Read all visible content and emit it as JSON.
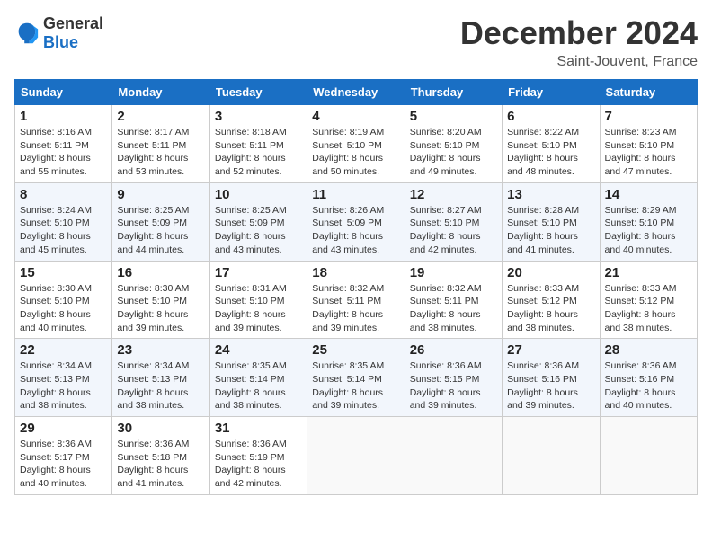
{
  "header": {
    "logo": {
      "general": "General",
      "blue": "Blue"
    },
    "title": "December 2024",
    "location": "Saint-Jouvent, France"
  },
  "calendar": {
    "days_of_week": [
      "Sunday",
      "Monday",
      "Tuesday",
      "Wednesday",
      "Thursday",
      "Friday",
      "Saturday"
    ],
    "weeks": [
      [
        null,
        null,
        {
          "day": "3",
          "sunrise": "Sunrise: 8:18 AM",
          "sunset": "Sunset: 5:11 PM",
          "daylight": "Daylight: 8 hours and 52 minutes."
        },
        {
          "day": "4",
          "sunrise": "Sunrise: 8:19 AM",
          "sunset": "Sunset: 5:10 PM",
          "daylight": "Daylight: 8 hours and 50 minutes."
        },
        {
          "day": "5",
          "sunrise": "Sunrise: 8:20 AM",
          "sunset": "Sunset: 5:10 PM",
          "daylight": "Daylight: 8 hours and 49 minutes."
        },
        {
          "day": "6",
          "sunrise": "Sunrise: 8:22 AM",
          "sunset": "Sunset: 5:10 PM",
          "daylight": "Daylight: 8 hours and 48 minutes."
        },
        {
          "day": "7",
          "sunrise": "Sunrise: 8:23 AM",
          "sunset": "Sunset: 5:10 PM",
          "daylight": "Daylight: 8 hours and 47 minutes."
        }
      ],
      [
        {
          "day": "1",
          "sunrise": "Sunrise: 8:16 AM",
          "sunset": "Sunset: 5:11 PM",
          "daylight": "Daylight: 8 hours and 55 minutes."
        },
        {
          "day": "2",
          "sunrise": "Sunrise: 8:17 AM",
          "sunset": "Sunset: 5:11 PM",
          "daylight": "Daylight: 8 hours and 53 minutes."
        },
        null,
        null,
        null,
        null,
        null
      ],
      [
        {
          "day": "8",
          "sunrise": "Sunrise: 8:24 AM",
          "sunset": "Sunset: 5:10 PM",
          "daylight": "Daylight: 8 hours and 45 minutes."
        },
        {
          "day": "9",
          "sunrise": "Sunrise: 8:25 AM",
          "sunset": "Sunset: 5:09 PM",
          "daylight": "Daylight: 8 hours and 44 minutes."
        },
        {
          "day": "10",
          "sunrise": "Sunrise: 8:25 AM",
          "sunset": "Sunset: 5:09 PM",
          "daylight": "Daylight: 8 hours and 43 minutes."
        },
        {
          "day": "11",
          "sunrise": "Sunrise: 8:26 AM",
          "sunset": "Sunset: 5:09 PM",
          "daylight": "Daylight: 8 hours and 43 minutes."
        },
        {
          "day": "12",
          "sunrise": "Sunrise: 8:27 AM",
          "sunset": "Sunset: 5:10 PM",
          "daylight": "Daylight: 8 hours and 42 minutes."
        },
        {
          "day": "13",
          "sunrise": "Sunrise: 8:28 AM",
          "sunset": "Sunset: 5:10 PM",
          "daylight": "Daylight: 8 hours and 41 minutes."
        },
        {
          "day": "14",
          "sunrise": "Sunrise: 8:29 AM",
          "sunset": "Sunset: 5:10 PM",
          "daylight": "Daylight: 8 hours and 40 minutes."
        }
      ],
      [
        {
          "day": "15",
          "sunrise": "Sunrise: 8:30 AM",
          "sunset": "Sunset: 5:10 PM",
          "daylight": "Daylight: 8 hours and 40 minutes."
        },
        {
          "day": "16",
          "sunrise": "Sunrise: 8:30 AM",
          "sunset": "Sunset: 5:10 PM",
          "daylight": "Daylight: 8 hours and 39 minutes."
        },
        {
          "day": "17",
          "sunrise": "Sunrise: 8:31 AM",
          "sunset": "Sunset: 5:10 PM",
          "daylight": "Daylight: 8 hours and 39 minutes."
        },
        {
          "day": "18",
          "sunrise": "Sunrise: 8:32 AM",
          "sunset": "Sunset: 5:11 PM",
          "daylight": "Daylight: 8 hours and 39 minutes."
        },
        {
          "day": "19",
          "sunrise": "Sunrise: 8:32 AM",
          "sunset": "Sunset: 5:11 PM",
          "daylight": "Daylight: 8 hours and 38 minutes."
        },
        {
          "day": "20",
          "sunrise": "Sunrise: 8:33 AM",
          "sunset": "Sunset: 5:12 PM",
          "daylight": "Daylight: 8 hours and 38 minutes."
        },
        {
          "day": "21",
          "sunrise": "Sunrise: 8:33 AM",
          "sunset": "Sunset: 5:12 PM",
          "daylight": "Daylight: 8 hours and 38 minutes."
        }
      ],
      [
        {
          "day": "22",
          "sunrise": "Sunrise: 8:34 AM",
          "sunset": "Sunset: 5:13 PM",
          "daylight": "Daylight: 8 hours and 38 minutes."
        },
        {
          "day": "23",
          "sunrise": "Sunrise: 8:34 AM",
          "sunset": "Sunset: 5:13 PM",
          "daylight": "Daylight: 8 hours and 38 minutes."
        },
        {
          "day": "24",
          "sunrise": "Sunrise: 8:35 AM",
          "sunset": "Sunset: 5:14 PM",
          "daylight": "Daylight: 8 hours and 38 minutes."
        },
        {
          "day": "25",
          "sunrise": "Sunrise: 8:35 AM",
          "sunset": "Sunset: 5:14 PM",
          "daylight": "Daylight: 8 hours and 39 minutes."
        },
        {
          "day": "26",
          "sunrise": "Sunrise: 8:36 AM",
          "sunset": "Sunset: 5:15 PM",
          "daylight": "Daylight: 8 hours and 39 minutes."
        },
        {
          "day": "27",
          "sunrise": "Sunrise: 8:36 AM",
          "sunset": "Sunset: 5:16 PM",
          "daylight": "Daylight: 8 hours and 39 minutes."
        },
        {
          "day": "28",
          "sunrise": "Sunrise: 8:36 AM",
          "sunset": "Sunset: 5:16 PM",
          "daylight": "Daylight: 8 hours and 40 minutes."
        }
      ],
      [
        {
          "day": "29",
          "sunrise": "Sunrise: 8:36 AM",
          "sunset": "Sunset: 5:17 PM",
          "daylight": "Daylight: 8 hours and 40 minutes."
        },
        {
          "day": "30",
          "sunrise": "Sunrise: 8:36 AM",
          "sunset": "Sunset: 5:18 PM",
          "daylight": "Daylight: 8 hours and 41 minutes."
        },
        {
          "day": "31",
          "sunrise": "Sunrise: 8:36 AM",
          "sunset": "Sunset: 5:19 PM",
          "daylight": "Daylight: 8 hours and 42 minutes."
        },
        null,
        null,
        null,
        null
      ]
    ]
  }
}
